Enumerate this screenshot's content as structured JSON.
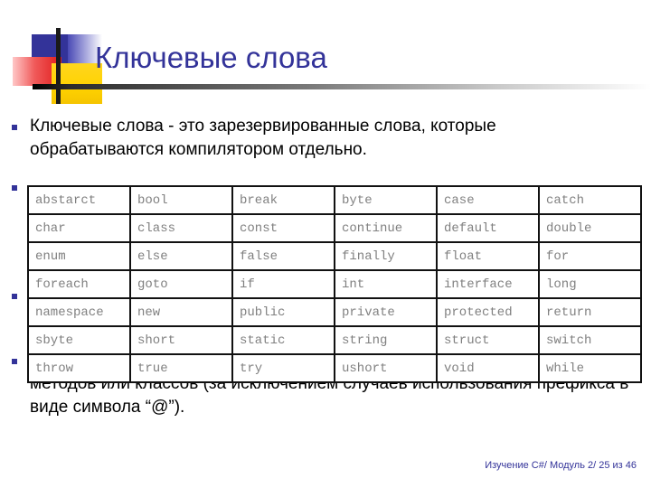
{
  "slide": {
    "title": "Ключевые слова",
    "footer": "Изучение C#/ Модуль 2/ 25 из 46",
    "accent_color": "#333399",
    "body_color": "#000000",
    "table_text_color": "#808080",
    "decoration": {
      "blue_block": "#333399",
      "red_block": "#e01b1b",
      "yellow_block": "#ffd200",
      "bar": "#1a1a1a"
    }
  },
  "bullets": [
    {
      "id": "para1",
      "text": "Ключевые слова - это зарезервированные слова, которые обрабатываются компилятором отдельно."
    },
    {
      "id": "para4",
      "text": "Ключевые слова не могут быть использованы в именах переменных, методов или классов (за исключением случаев использования префикса в виде символа “@”)."
    }
  ],
  "keyword_table": {
    "columns": 6,
    "rows": [
      [
        "abstarct",
        "bool",
        "break",
        "byte",
        "case",
        "catch"
      ],
      [
        "char",
        "class",
        "const",
        "continue",
        "default",
        "double"
      ],
      [
        "enum",
        "else",
        "false",
        "finally",
        "float",
        "for"
      ],
      [
        "foreach",
        "goto",
        "if",
        "int",
        "interface",
        "long"
      ],
      [
        "namespace",
        "new",
        "public",
        "private",
        "protected",
        "return"
      ],
      [
        "sbyte",
        "short",
        "static",
        "string",
        "struct",
        "switch"
      ],
      [
        "throw",
        "true",
        "try",
        "ushort",
        "void",
        "while"
      ]
    ]
  }
}
